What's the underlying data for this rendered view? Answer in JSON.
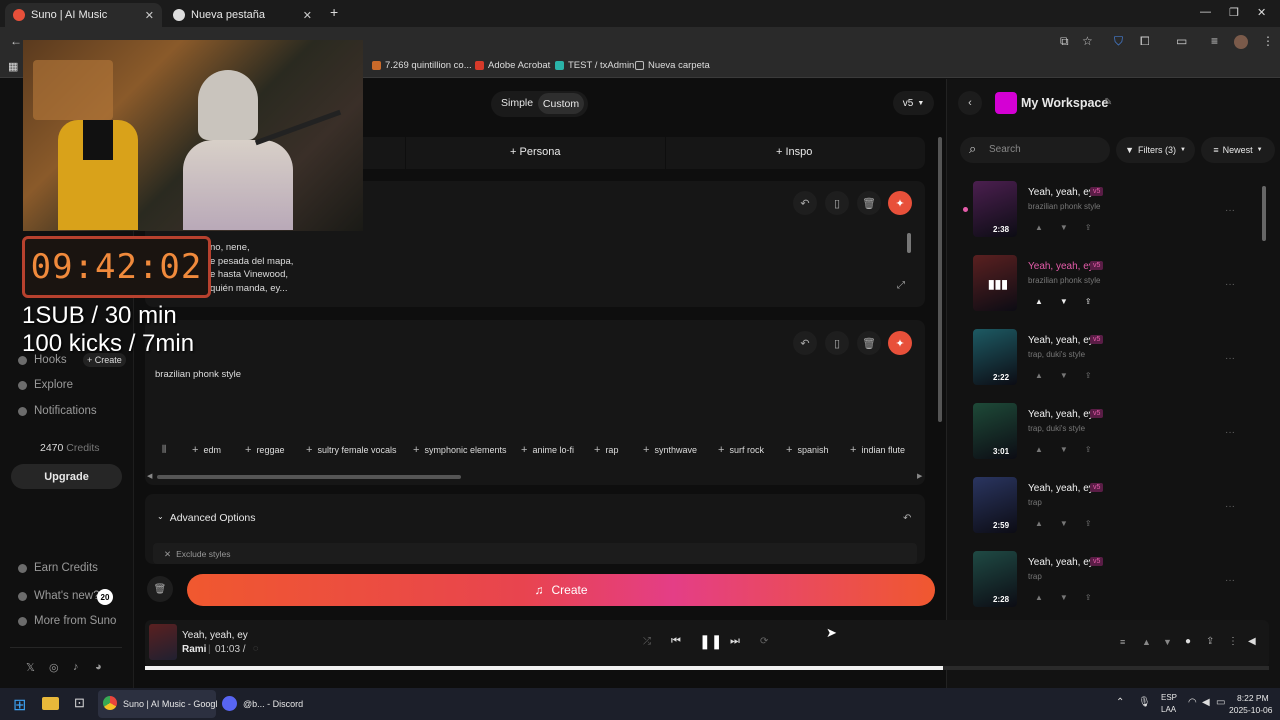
{
  "browser": {
    "tabs": [
      {
        "title": "Suno | AI Music",
        "active": true
      },
      {
        "title": "Nueva pestaña",
        "active": false
      }
    ],
    "bookmarks": [
      "7.269 quintillion co...",
      "Adobe Acrobat",
      "TEST / txAdmin",
      "Nueva carpeta"
    ]
  },
  "header": {
    "mode_simple": "Simple",
    "mode_custom": "Custom",
    "version": "v5"
  },
  "tabs_row": {
    "persona": "Persona",
    "inspo": "Inspo"
  },
  "lyrics": {
    "lines": [
      "no, nene,",
      "e pesada del mapa,",
      "e hasta Vinewood,",
      "quién manda, ey..."
    ]
  },
  "styles": {
    "text": "brazilian phonk style",
    "chips": [
      "edm",
      "reggae",
      "sultry female vocals",
      "symphonic elements",
      "anime lo-fi",
      "rap",
      "synthwave",
      "surf rock",
      "spanish",
      "indian flute"
    ]
  },
  "advanced": {
    "label": "Advanced Options",
    "exclude": "Exclude styles"
  },
  "create_label": "Create",
  "sidebar": {
    "items": [
      "Hooks",
      "Explore",
      "Notifications"
    ],
    "create_small": "+ Create",
    "credits_value": "2470",
    "credits_label": "Credits",
    "upgrade": "Upgrade",
    "bottom": [
      "Earn Credits",
      "What's new?",
      "More from Suno"
    ],
    "whats_new_count": "20"
  },
  "workspace": {
    "title": "My Workspace",
    "search_placeholder": "Search",
    "filters": "Filters (3)",
    "sort": "Newest",
    "songs": [
      {
        "title": "Yeah, yeah, ey",
        "version": "v5",
        "style": "brazilian phonk style",
        "duration": "2:38",
        "color": "#4b1f4f"
      },
      {
        "title": "Yeah, yeah, ey",
        "version": "v5",
        "style": "brazilian phonk style",
        "duration": "",
        "color": "#5a2020"
      },
      {
        "title": "Yeah, yeah, ey",
        "version": "v5",
        "style": "trap, duki's style",
        "duration": "2:22",
        "color": "#1d5a63"
      },
      {
        "title": "Yeah, yeah, ey",
        "version": "v5",
        "style": "trap, duki's style",
        "duration": "3:01",
        "color": "#1e4a38"
      },
      {
        "title": "Yeah, yeah, ey",
        "version": "v5",
        "style": "trap",
        "duration": "2:59",
        "color": "#2a3560"
      },
      {
        "title": "Yeah, yeah, ey",
        "version": "v5",
        "style": "trap",
        "duration": "2:28",
        "color": "#1f4a44"
      }
    ]
  },
  "player": {
    "title": "Yeah, yeah, ey",
    "artist": "Rami",
    "time": "01:03 /",
    "progress": 0.71
  },
  "overlay": {
    "timer": "09:42:02",
    "line1": "1SUB / 30 min",
    "line2": "100 kicks / 7min"
  },
  "taskbar": {
    "chrome": "Suno | AI Music - Googl",
    "discord": "@b... - Discord",
    "lang1": "ESP",
    "lang2": "LAA",
    "time": "8:22 PM",
    "date": "2025-10-06"
  },
  "colors": {
    "accent": "#e8503a",
    "pink": "#e55caa",
    "create_from": "#f0582f",
    "create_to": "#e43e86"
  }
}
